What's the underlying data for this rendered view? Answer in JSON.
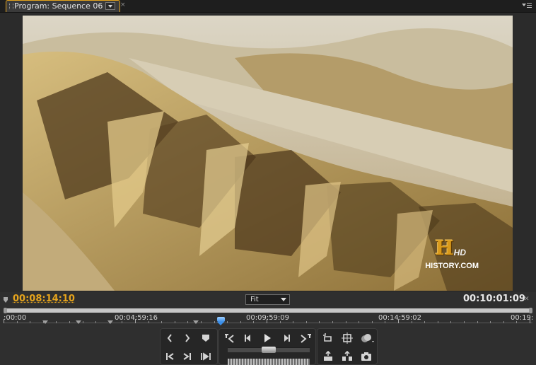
{
  "panel": {
    "tab_title": "Program: Sequence 06",
    "tab_close": "×"
  },
  "video": {
    "watermark_letter": "H",
    "watermark_hd": "HD",
    "watermark_site": "HISTORY.COM"
  },
  "timecode": {
    "current": "00:08:14:10",
    "duration": "00:10:01:09",
    "zoom": "Fit"
  },
  "ruler": {
    "labels": [
      ":00:00",
      "00:04:59:16",
      "00:09:59:09",
      "00:14:59:02",
      "00:19:"
    ]
  },
  "colors": {
    "accent": "#e6a41c",
    "playhead": "#3a8ee8",
    "panel_bg": "#2f2f2f"
  },
  "transport": {
    "row1": [
      "mark-in",
      "mark-out",
      "set-marker",
      "go-to-in",
      "step-back",
      "play",
      "step-forward",
      "go-to-out",
      "loop",
      "safe-margins",
      "output"
    ],
    "row2": [
      "play-in-to-out",
      "lift",
      "extract",
      "trim",
      "export-frame"
    ]
  }
}
